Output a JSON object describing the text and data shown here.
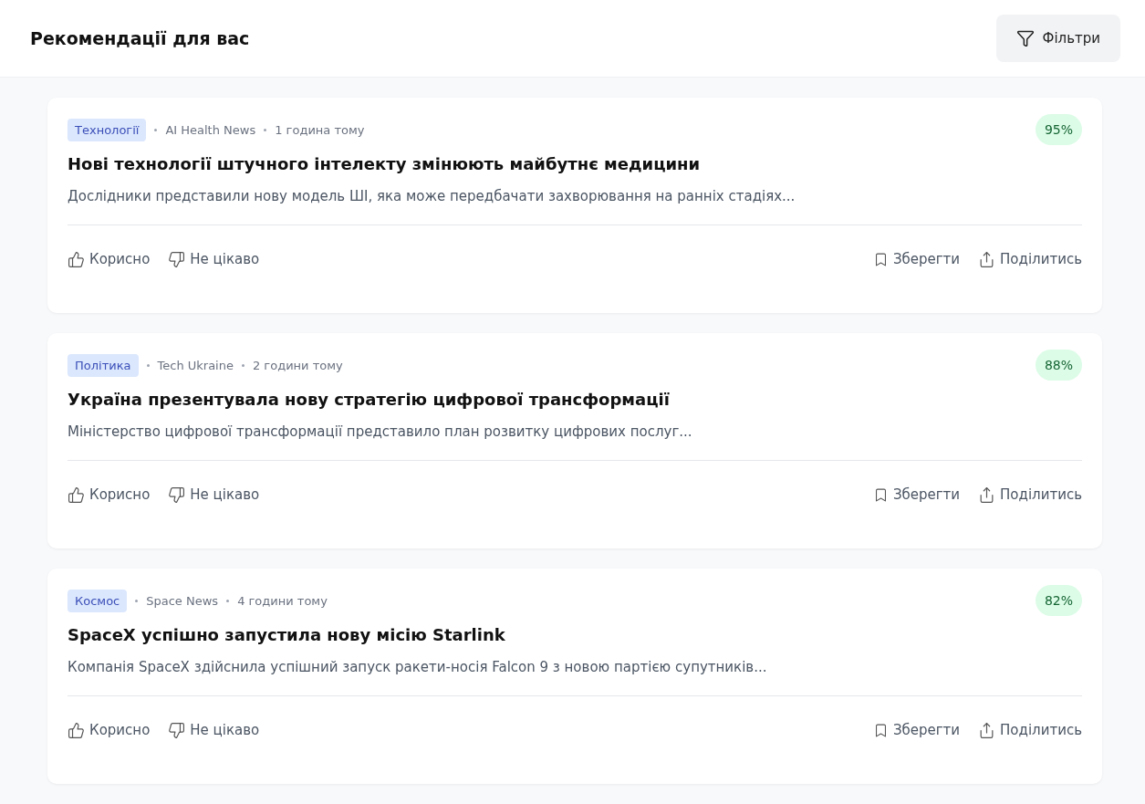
{
  "header": {
    "title": "Рекомендації для вас",
    "filter_button": "Фільтри"
  },
  "articles": [
    {
      "category": "Технології",
      "source": "AI Health News",
      "time": "1 година тому",
      "score": "95%",
      "title": "Нові технології штучного інтелекту змінюють майбутнє медицини",
      "summary": "Дослідники представили нову модель ШІ, яка може передбачати захворювання на ранніх стадіях...",
      "actions": [
        "Корисно",
        "Не цікаво",
        "Зберегти",
        "Поділитись"
      ]
    },
    {
      "category": "Політика",
      "source": "Tech Ukraine",
      "time": "2 години тому",
      "score": "88%",
      "title": "Україна презентувала нову стратегію цифрової трансформації",
      "summary": "Міністерство цифрової трансформації представило план розвитку цифрових послуг...",
      "actions": [
        "Корисно",
        "Не цікаво",
        "Зберегти",
        "Поділитись"
      ]
    },
    {
      "category": "Космос",
      "source": "Space News",
      "time": "4 години тому",
      "score": "82%",
      "title": "SpaceX успішно запустила нову місію Starlink",
      "summary": "Компанія SpaceX здійснила успішний запуск ракети-носія Falcon 9 з новою партією супутників...",
      "actions": [
        "Корисно",
        "Не цікаво",
        "Зберегти",
        "Поділитись"
      ]
    }
  ]
}
